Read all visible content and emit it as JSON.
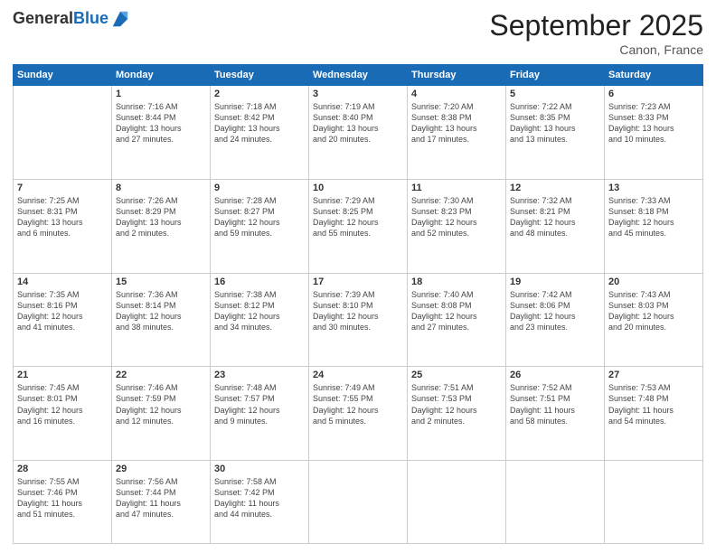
{
  "header": {
    "logo_general": "General",
    "logo_blue": "Blue",
    "month_title": "September 2025",
    "location": "Canon, France"
  },
  "weekdays": [
    "Sunday",
    "Monday",
    "Tuesday",
    "Wednesday",
    "Thursday",
    "Friday",
    "Saturday"
  ],
  "weeks": [
    [
      {
        "day": "",
        "text": ""
      },
      {
        "day": "1",
        "text": "Sunrise: 7:16 AM\nSunset: 8:44 PM\nDaylight: 13 hours\nand 27 minutes."
      },
      {
        "day": "2",
        "text": "Sunrise: 7:18 AM\nSunset: 8:42 PM\nDaylight: 13 hours\nand 24 minutes."
      },
      {
        "day": "3",
        "text": "Sunrise: 7:19 AM\nSunset: 8:40 PM\nDaylight: 13 hours\nand 20 minutes."
      },
      {
        "day": "4",
        "text": "Sunrise: 7:20 AM\nSunset: 8:38 PM\nDaylight: 13 hours\nand 17 minutes."
      },
      {
        "day": "5",
        "text": "Sunrise: 7:22 AM\nSunset: 8:35 PM\nDaylight: 13 hours\nand 13 minutes."
      },
      {
        "day": "6",
        "text": "Sunrise: 7:23 AM\nSunset: 8:33 PM\nDaylight: 13 hours\nand 10 minutes."
      }
    ],
    [
      {
        "day": "7",
        "text": "Sunrise: 7:25 AM\nSunset: 8:31 PM\nDaylight: 13 hours\nand 6 minutes."
      },
      {
        "day": "8",
        "text": "Sunrise: 7:26 AM\nSunset: 8:29 PM\nDaylight: 13 hours\nand 2 minutes."
      },
      {
        "day": "9",
        "text": "Sunrise: 7:28 AM\nSunset: 8:27 PM\nDaylight: 12 hours\nand 59 minutes."
      },
      {
        "day": "10",
        "text": "Sunrise: 7:29 AM\nSunset: 8:25 PM\nDaylight: 12 hours\nand 55 minutes."
      },
      {
        "day": "11",
        "text": "Sunrise: 7:30 AM\nSunset: 8:23 PM\nDaylight: 12 hours\nand 52 minutes."
      },
      {
        "day": "12",
        "text": "Sunrise: 7:32 AM\nSunset: 8:21 PM\nDaylight: 12 hours\nand 48 minutes."
      },
      {
        "day": "13",
        "text": "Sunrise: 7:33 AM\nSunset: 8:18 PM\nDaylight: 12 hours\nand 45 minutes."
      }
    ],
    [
      {
        "day": "14",
        "text": "Sunrise: 7:35 AM\nSunset: 8:16 PM\nDaylight: 12 hours\nand 41 minutes."
      },
      {
        "day": "15",
        "text": "Sunrise: 7:36 AM\nSunset: 8:14 PM\nDaylight: 12 hours\nand 38 minutes."
      },
      {
        "day": "16",
        "text": "Sunrise: 7:38 AM\nSunset: 8:12 PM\nDaylight: 12 hours\nand 34 minutes."
      },
      {
        "day": "17",
        "text": "Sunrise: 7:39 AM\nSunset: 8:10 PM\nDaylight: 12 hours\nand 30 minutes."
      },
      {
        "day": "18",
        "text": "Sunrise: 7:40 AM\nSunset: 8:08 PM\nDaylight: 12 hours\nand 27 minutes."
      },
      {
        "day": "19",
        "text": "Sunrise: 7:42 AM\nSunset: 8:06 PM\nDaylight: 12 hours\nand 23 minutes."
      },
      {
        "day": "20",
        "text": "Sunrise: 7:43 AM\nSunset: 8:03 PM\nDaylight: 12 hours\nand 20 minutes."
      }
    ],
    [
      {
        "day": "21",
        "text": "Sunrise: 7:45 AM\nSunset: 8:01 PM\nDaylight: 12 hours\nand 16 minutes."
      },
      {
        "day": "22",
        "text": "Sunrise: 7:46 AM\nSunset: 7:59 PM\nDaylight: 12 hours\nand 12 minutes."
      },
      {
        "day": "23",
        "text": "Sunrise: 7:48 AM\nSunset: 7:57 PM\nDaylight: 12 hours\nand 9 minutes."
      },
      {
        "day": "24",
        "text": "Sunrise: 7:49 AM\nSunset: 7:55 PM\nDaylight: 12 hours\nand 5 minutes."
      },
      {
        "day": "25",
        "text": "Sunrise: 7:51 AM\nSunset: 7:53 PM\nDaylight: 12 hours\nand 2 minutes."
      },
      {
        "day": "26",
        "text": "Sunrise: 7:52 AM\nSunset: 7:51 PM\nDaylight: 11 hours\nand 58 minutes."
      },
      {
        "day": "27",
        "text": "Sunrise: 7:53 AM\nSunset: 7:48 PM\nDaylight: 11 hours\nand 54 minutes."
      }
    ],
    [
      {
        "day": "28",
        "text": "Sunrise: 7:55 AM\nSunset: 7:46 PM\nDaylight: 11 hours\nand 51 minutes."
      },
      {
        "day": "29",
        "text": "Sunrise: 7:56 AM\nSunset: 7:44 PM\nDaylight: 11 hours\nand 47 minutes."
      },
      {
        "day": "30",
        "text": "Sunrise: 7:58 AM\nSunset: 7:42 PM\nDaylight: 11 hours\nand 44 minutes."
      },
      {
        "day": "",
        "text": ""
      },
      {
        "day": "",
        "text": ""
      },
      {
        "day": "",
        "text": ""
      },
      {
        "day": "",
        "text": ""
      }
    ]
  ]
}
